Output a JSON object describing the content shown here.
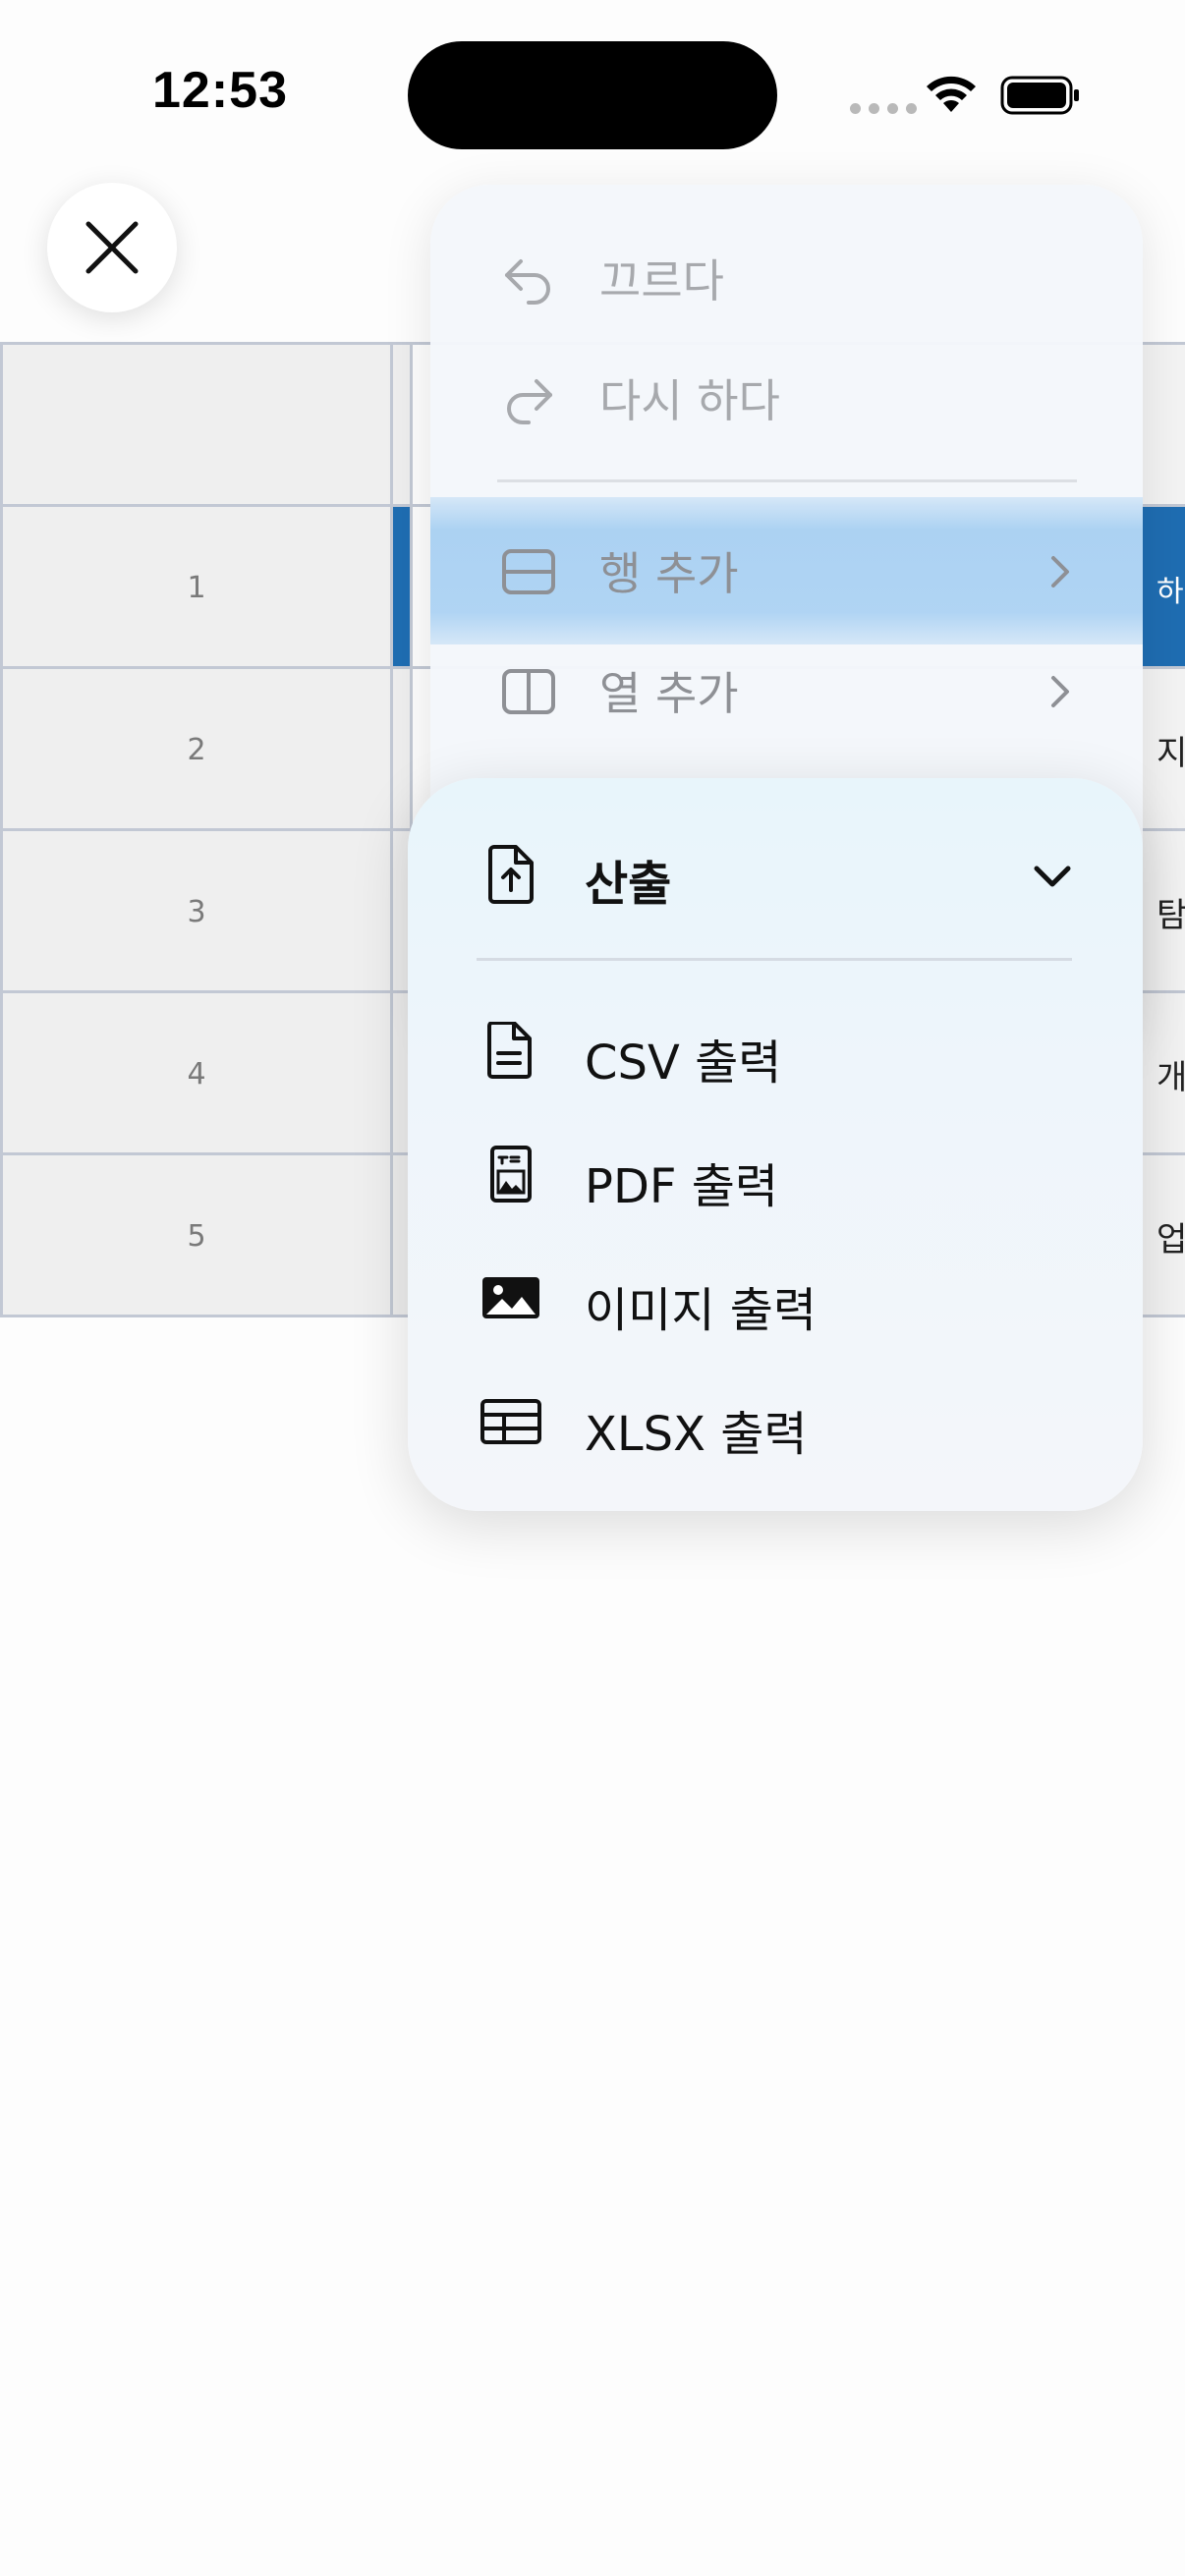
{
  "status_bar": {
    "time": "12:53"
  },
  "spreadsheet": {
    "rows": [
      {
        "number": "1",
        "edge_text": "하",
        "selected": true
      },
      {
        "number": "2",
        "edge_text": "지",
        "selected": false
      },
      {
        "number": "3",
        "edge_text": "탐",
        "selected": false
      },
      {
        "number": "4",
        "edge_text": "개",
        "selected": false
      },
      {
        "number": "5",
        "edge_text": "업",
        "selected": false
      }
    ],
    "selection_color": "#1f6db2"
  },
  "menu": {
    "undo_label": "끄르다",
    "redo_label": "다시 하다",
    "add_row_label": "행 추가",
    "add_column_label": "열 추가",
    "highlight_color": "#acd2f3"
  },
  "export_menu": {
    "title": "산출",
    "items": [
      {
        "label": "CSV 출력",
        "icon": "document-text-icon"
      },
      {
        "label": "PDF 출력",
        "icon": "document-image-icon"
      },
      {
        "label": "이미지 출력",
        "icon": "image-icon"
      },
      {
        "label": "XLSX 출력",
        "icon": "table-icon"
      }
    ]
  }
}
